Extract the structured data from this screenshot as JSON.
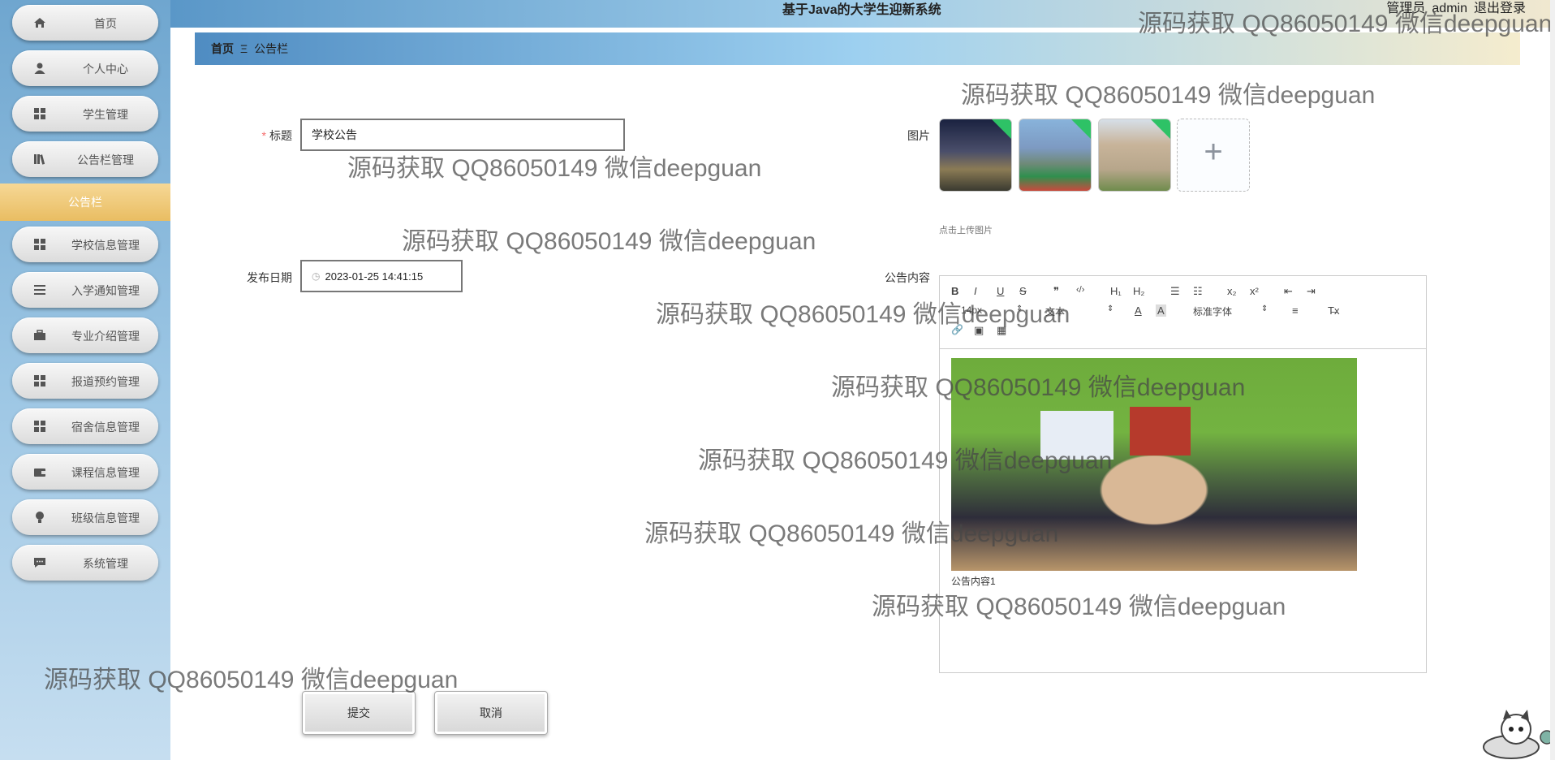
{
  "app": {
    "title": "基于Java的大学生迎新系统",
    "admin_prefix": "管理员",
    "admin_name": "admin",
    "logout": "退出登录"
  },
  "sidebar": {
    "items": [
      {
        "label": "首页",
        "icon": "home-icon"
      },
      {
        "label": "个人中心",
        "icon": "user-icon"
      },
      {
        "label": "学生管理",
        "icon": "grid-icon"
      },
      {
        "label": "公告栏管理",
        "icon": "book-icon"
      },
      {
        "label": "学校信息管理",
        "icon": "grid-icon"
      },
      {
        "label": "入学通知管理",
        "icon": "list-icon"
      },
      {
        "label": "专业介绍管理",
        "icon": "briefcase-icon"
      },
      {
        "label": "报道预约管理",
        "icon": "grid-icon"
      },
      {
        "label": "宿舍信息管理",
        "icon": "grid-icon"
      },
      {
        "label": "课程信息管理",
        "icon": "wallet-icon"
      },
      {
        "label": "班级信息管理",
        "icon": "bulb-icon"
      },
      {
        "label": "系统管理",
        "icon": "chat-icon"
      }
    ],
    "active_sub": "公告栏"
  },
  "breadcrumb": {
    "home": "首页",
    "separator": "Ξ",
    "current": "公告栏"
  },
  "form": {
    "title_label": "标题",
    "title_value": "学校公告",
    "image_label": "图片",
    "upload_hint": "点击上传图片",
    "date_label": "发布日期",
    "date_value": "2023-01-25 14:41:15",
    "content_label": "公告内容",
    "toolbar": {
      "bold": "B",
      "italic": "I",
      "underline": "U",
      "strike": "S",
      "quote": "❞",
      "code": "‹/›",
      "h1": "H₁",
      "h2": "H₂",
      "ordered": "☰",
      "bullet": "☷",
      "sub": "x₂",
      "sup": "x²",
      "outdent": "⇤",
      "indent": "⇥",
      "size_select": "14px",
      "font_select": "文本",
      "font_family": "标准字体",
      "color": "A",
      "bg": "A",
      "align": "≡",
      "clean": "T̶x",
      "link": "🔗",
      "image": "▣",
      "video": "▦"
    },
    "content_caption": "公告内容1",
    "submit": "提交",
    "cancel": "取消"
  },
  "watermark": "源码获取 QQ86050149 微信deepguan",
  "colors": {
    "accent": "#e9bd62",
    "required": "#f56c6c",
    "upload_badge": "#2ec266"
  }
}
